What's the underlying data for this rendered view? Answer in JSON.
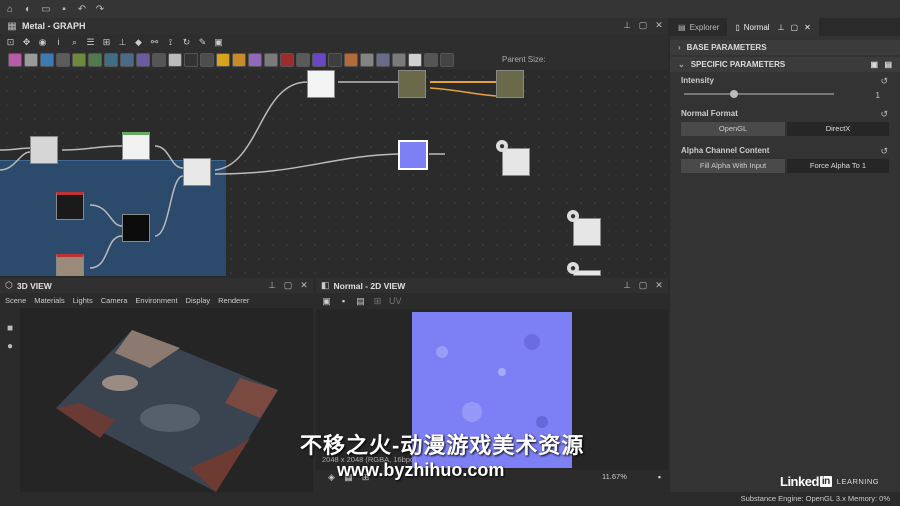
{
  "app_toolbar": {
    "icons": [
      "home-icon",
      "open-icon",
      "folder-icon",
      "save-icon",
      "undo-icon",
      "redo-icon"
    ]
  },
  "graph": {
    "title": "Metal - GRAPH",
    "parent_size_label": "Parent Size:"
  },
  "right_panel": {
    "tabs": [
      {
        "label": "Explorer"
      },
      {
        "label": "Normal"
      }
    ],
    "base_parameters": "BASE PARAMETERS",
    "specific_parameters": "SPECIFIC PARAMETERS",
    "intensity": {
      "label": "Intensity",
      "value": "1",
      "fraction": 0.33
    },
    "normal_format": {
      "label": "Normal Format",
      "options": [
        "OpenGL",
        "DirectX"
      ],
      "selected": "OpenGL"
    },
    "alpha_channel": {
      "label": "Alpha Channel Content",
      "options": [
        "Fill Alpha With Input",
        "Force Alpha To 1"
      ],
      "selected": "Fill Alpha With Input"
    }
  },
  "view3d": {
    "title": "3D VIEW",
    "menu": [
      "Scene",
      "Materials",
      "Lights",
      "Camera",
      "Environment",
      "Display",
      "Renderer"
    ]
  },
  "view2d": {
    "title": "Normal - 2D VIEW",
    "channel": "UV",
    "image_info": "2048 x 2048 (RGBA, 16bpc)",
    "zoom": "11.67%"
  },
  "status": {
    "engine": "Substance Engine: OpenGL 3.x  Memory: 0%"
  },
  "branding": {
    "linkedin": "Linked",
    "in": "in",
    "learning": "LEARNING"
  },
  "watermark": {
    "cn_text": "不移之火-动漫游戏美术资源",
    "url": "www.byzhihuo.com"
  },
  "colors": {
    "frame_blue": "#2c4a6b",
    "normal_map": "#7d80f4",
    "link_orange": "#e8a23a"
  }
}
